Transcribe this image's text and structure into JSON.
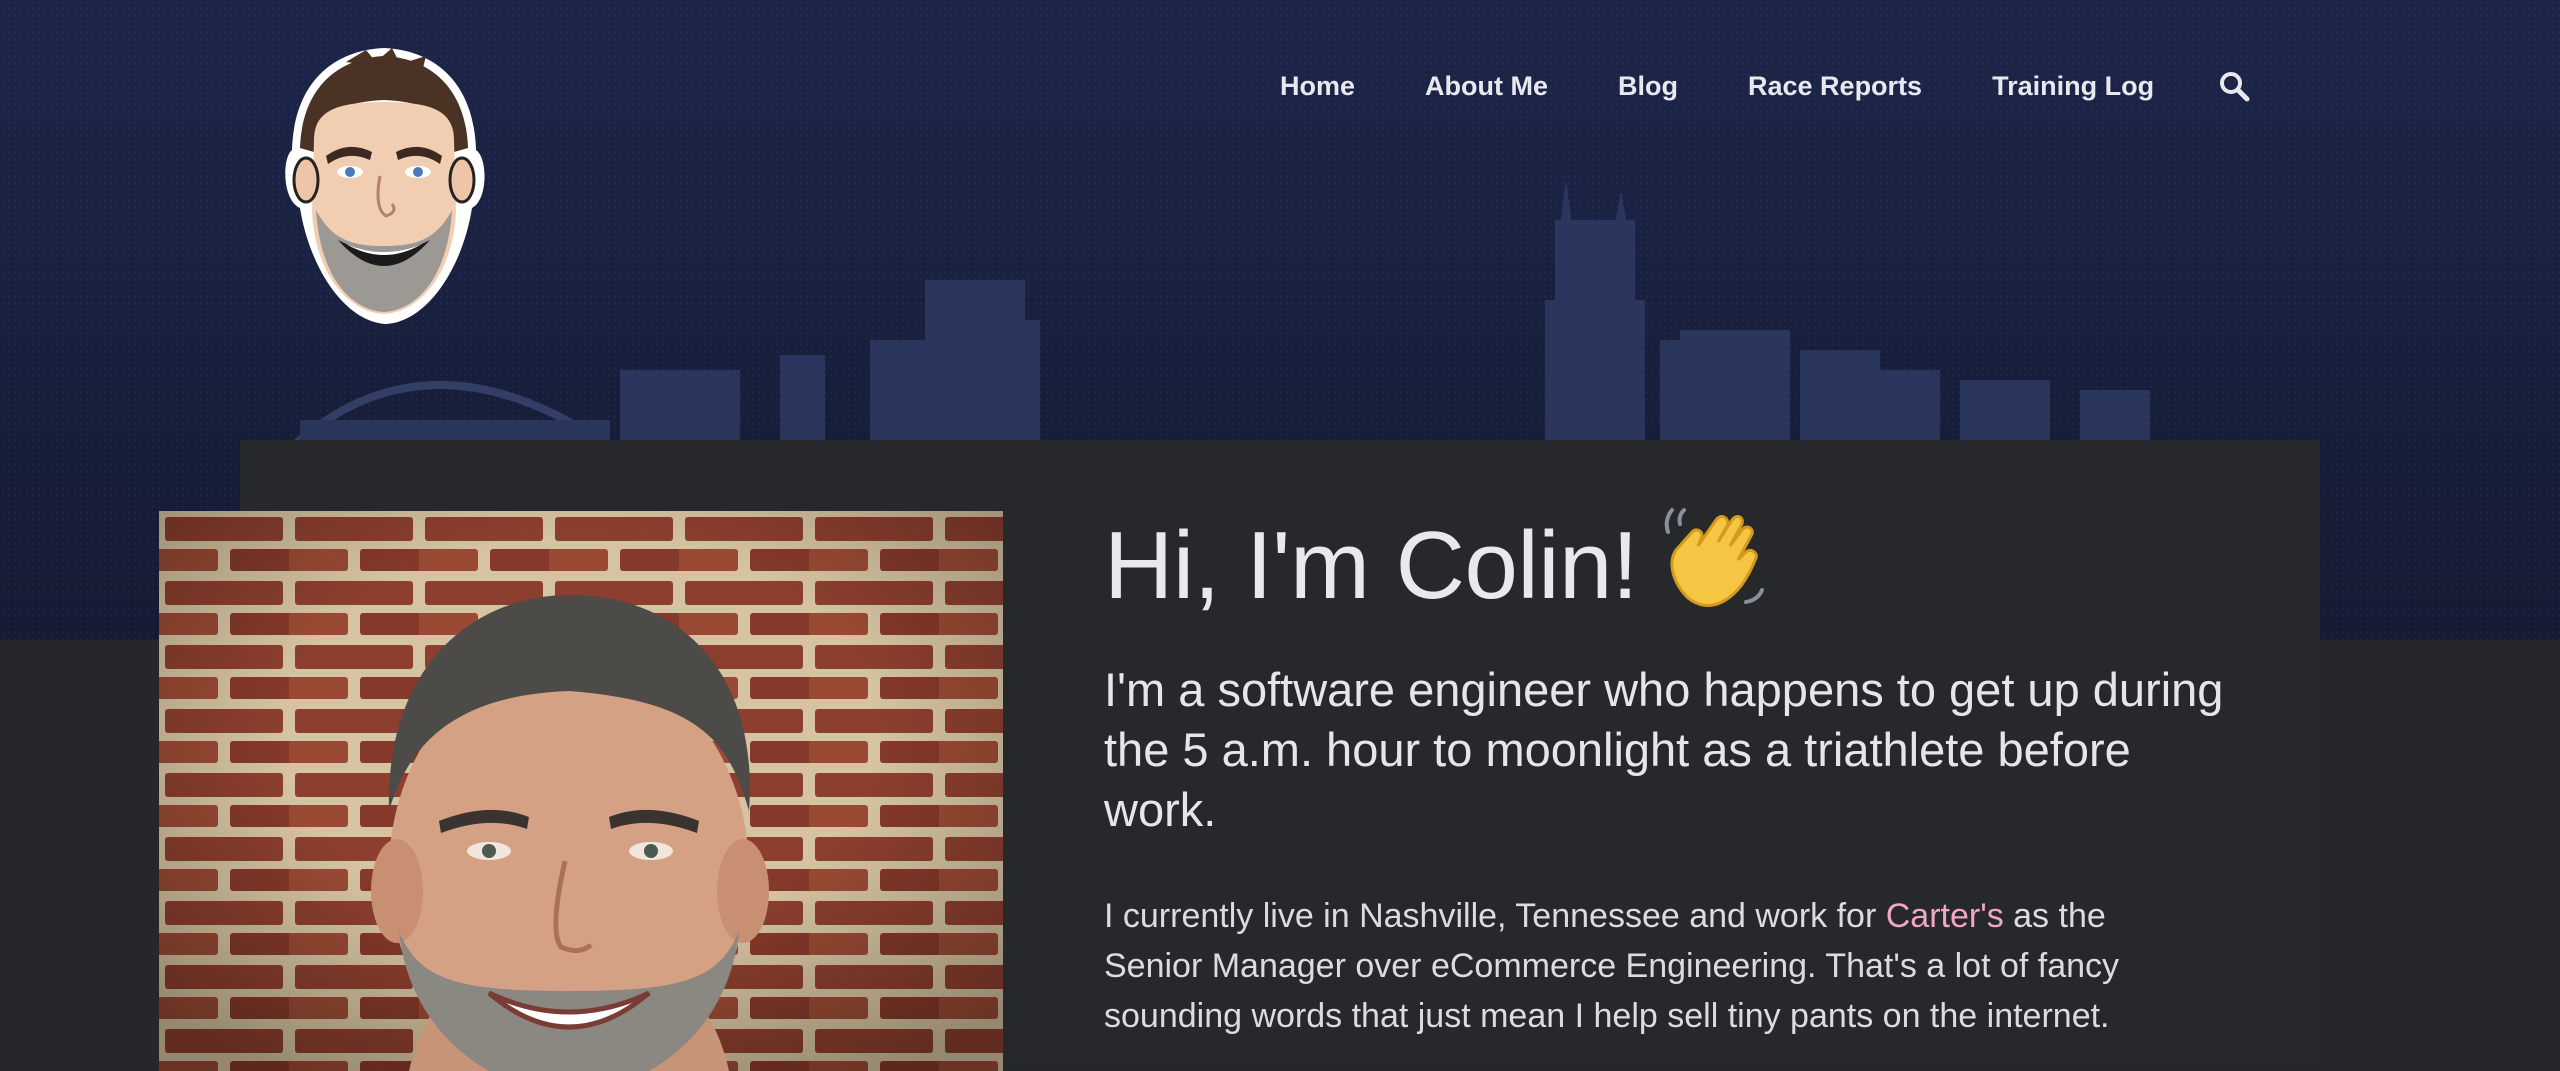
{
  "nav": {
    "items": [
      {
        "label": "Home"
      },
      {
        "label": "About Me"
      },
      {
        "label": "Blog"
      },
      {
        "label": "Race Reports"
      },
      {
        "label": "Training Log"
      }
    ],
    "search_icon": "search-icon"
  },
  "logo": {
    "icon": "cartoon-face-logo"
  },
  "intro": {
    "headline": "Hi, I'm Colin!",
    "headline_emoji": "waving-hand-icon",
    "tagline": "I'm a software engineer who happens to get up during the 5 a.m. hour to moonlight as a triathlete before work.",
    "bio_before": "I currently live in Nashville, Tennessee and work for ",
    "bio_link": "Carter's",
    "bio_after": " as the Senior Manager over eCommerce Engineering. That's a lot of fancy sounding words that just mean I help sell tiny pants on the internet."
  },
  "colors": {
    "hero_bg": "#1a2243",
    "page_bg": "#26272b",
    "card_bg": "#27282c",
    "link": "#f2a7c0",
    "text": "#e6e6e9"
  }
}
